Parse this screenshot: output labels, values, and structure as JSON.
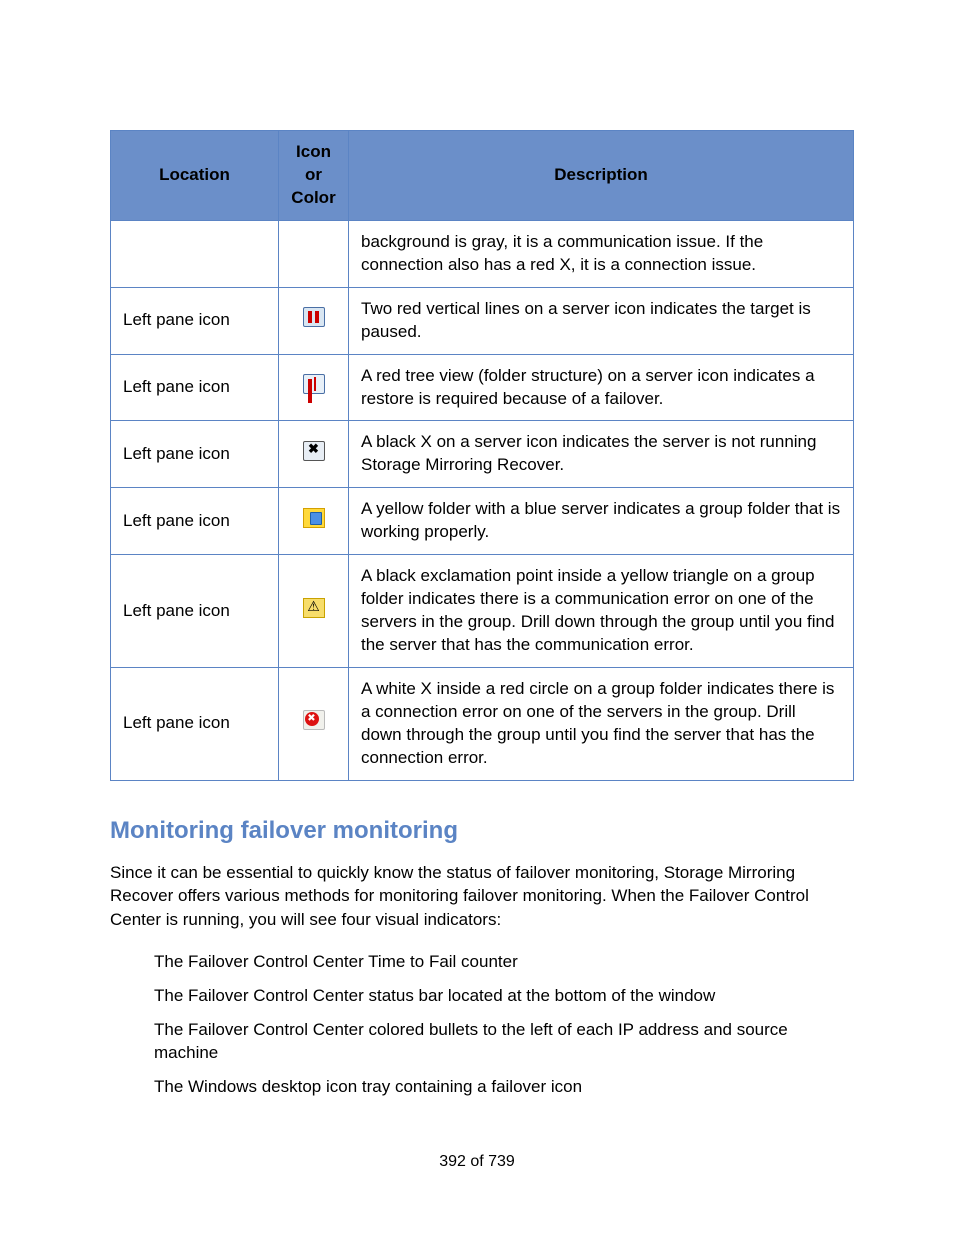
{
  "table": {
    "headers": {
      "location": "Location",
      "icon": "Icon or Color",
      "desc": "Description"
    },
    "rows": [
      {
        "location": "",
        "icon": "",
        "desc": "background is gray, it is a communication issue. If the connection also has a red X, it is a connection issue."
      },
      {
        "location": "Left pane icon",
        "icon": "server-paused-icon",
        "desc": "Two red vertical lines on a server icon indicates the target is paused."
      },
      {
        "location": "Left pane icon",
        "icon": "server-restore-required-icon",
        "desc": "A red tree view (folder structure) on a server icon indicates a restore is required because of a failover."
      },
      {
        "location": "Left pane icon",
        "icon": "server-not-running-icon",
        "desc": "A black X on a server icon indicates the server is not running Storage Mirroring Recover."
      },
      {
        "location": "Left pane icon",
        "icon": "group-folder-ok-icon",
        "desc": "A yellow folder with a blue server indicates a group folder that is working properly."
      },
      {
        "location": "Left pane icon",
        "icon": "group-folder-warning-icon",
        "desc": "A black exclamation point inside a yellow triangle on a group folder indicates there is a communication error on one of the servers in the group. Drill down through the group until you find the server that has the communication error."
      },
      {
        "location": "Left pane icon",
        "icon": "group-folder-error-icon",
        "desc": "A white X inside a red circle on a group folder indicates there is a connection error on one of the servers in the group. Drill down through the group until you find the server that has the connection error."
      }
    ]
  },
  "section": {
    "heading": "Monitoring failover monitoring",
    "intro": "Since it can be essential to quickly know the status of failover monitoring, Storage Mirroring Recover offers various methods for monitoring failover monitoring. When the Failover Control Center is running, you will see four visual indicators:",
    "bullets": [
      "The Failover Control Center Time to Fail counter",
      "The Failover Control Center status bar located at the bottom of the window",
      "The Failover Control Center colored bullets to the left of each IP address and source machine",
      "The Windows desktop icon tray containing a failover icon"
    ]
  },
  "footer": "392 of 739"
}
